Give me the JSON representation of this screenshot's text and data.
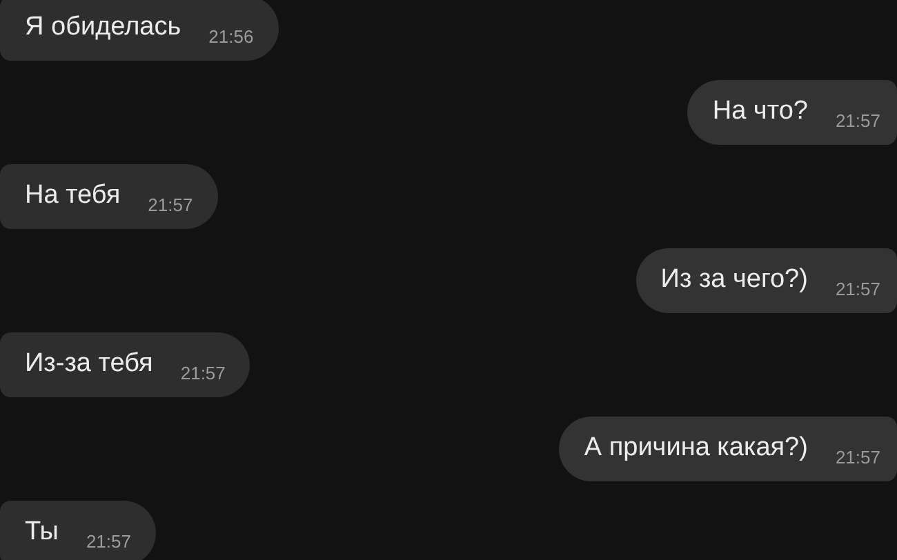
{
  "messages": [
    {
      "text": "Я обиделась",
      "time": "21:56",
      "outgoing": false
    },
    {
      "text": "На что?",
      "time": "21:57",
      "outgoing": true
    },
    {
      "text": "На тебя",
      "time": "21:57",
      "outgoing": false
    },
    {
      "text": "Из за чего?)",
      "time": "21:57",
      "outgoing": true
    },
    {
      "text": "Из-за тебя",
      "time": "21:57",
      "outgoing": false
    },
    {
      "text": "А причина какая?)",
      "time": "21:57",
      "outgoing": true
    },
    {
      "text": "Ты",
      "time": "21:57",
      "outgoing": false
    }
  ]
}
